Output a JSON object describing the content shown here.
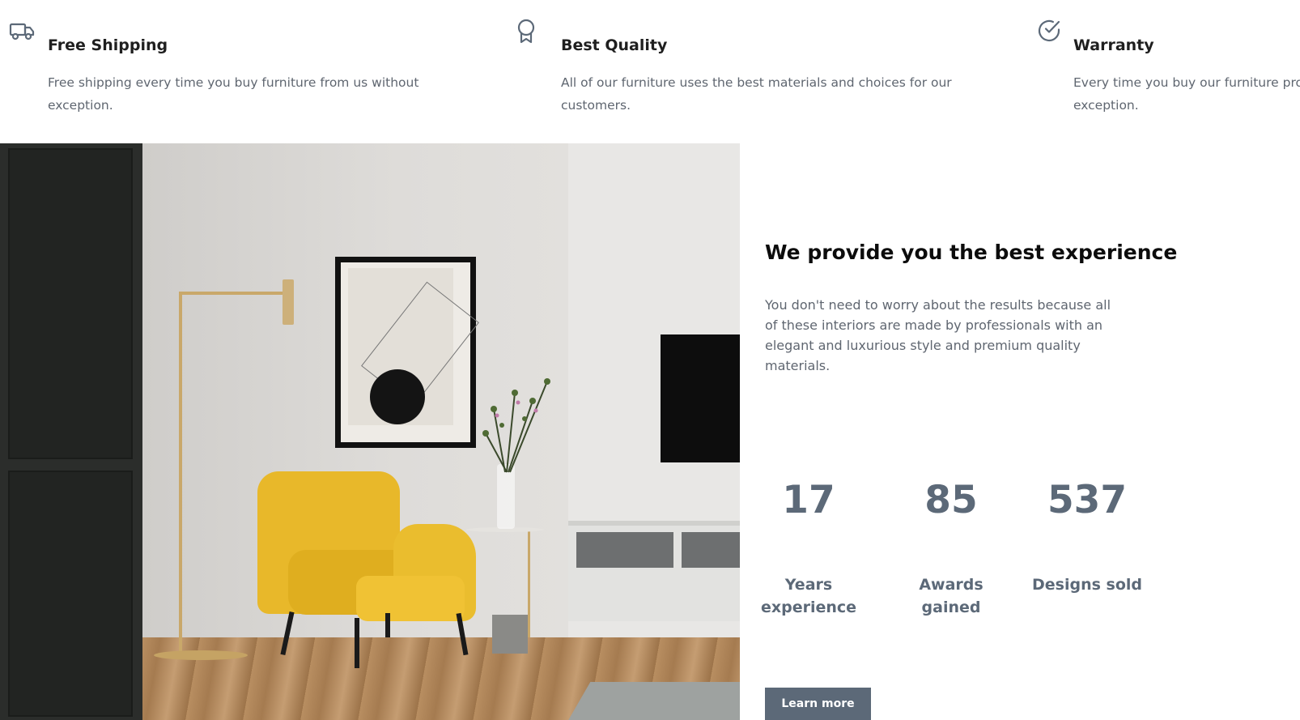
{
  "features": [
    {
      "icon": "truck-icon",
      "title": "Free Shipping",
      "description": "Free shipping every time you buy furniture from us without exception."
    },
    {
      "icon": "award-ribbon-icon",
      "title": "Best Quality",
      "description": "All of our furniture uses the best materials and choices for our customers."
    },
    {
      "icon": "check-circle-icon",
      "title": "Warranty",
      "description": "Every time you buy our furniture provides a warranty without exception."
    }
  ],
  "about": {
    "title": "We provide you the best experience",
    "text": "You don't need to worry about the results because all of these interiors are made by professionals with an elegant and luxurious style and premium quality materials.",
    "stats": [
      {
        "value": "17",
        "label": "Years experience"
      },
      {
        "value": "85",
        "label": "Awards gained"
      },
      {
        "value": "537",
        "label": "Designs sold"
      }
    ],
    "cta_label": "Learn more"
  },
  "colors": {
    "accent": "#5c6978",
    "heading": "#0c0c0c",
    "body_text": "#5f6670",
    "chair": "#e8b82a"
  }
}
